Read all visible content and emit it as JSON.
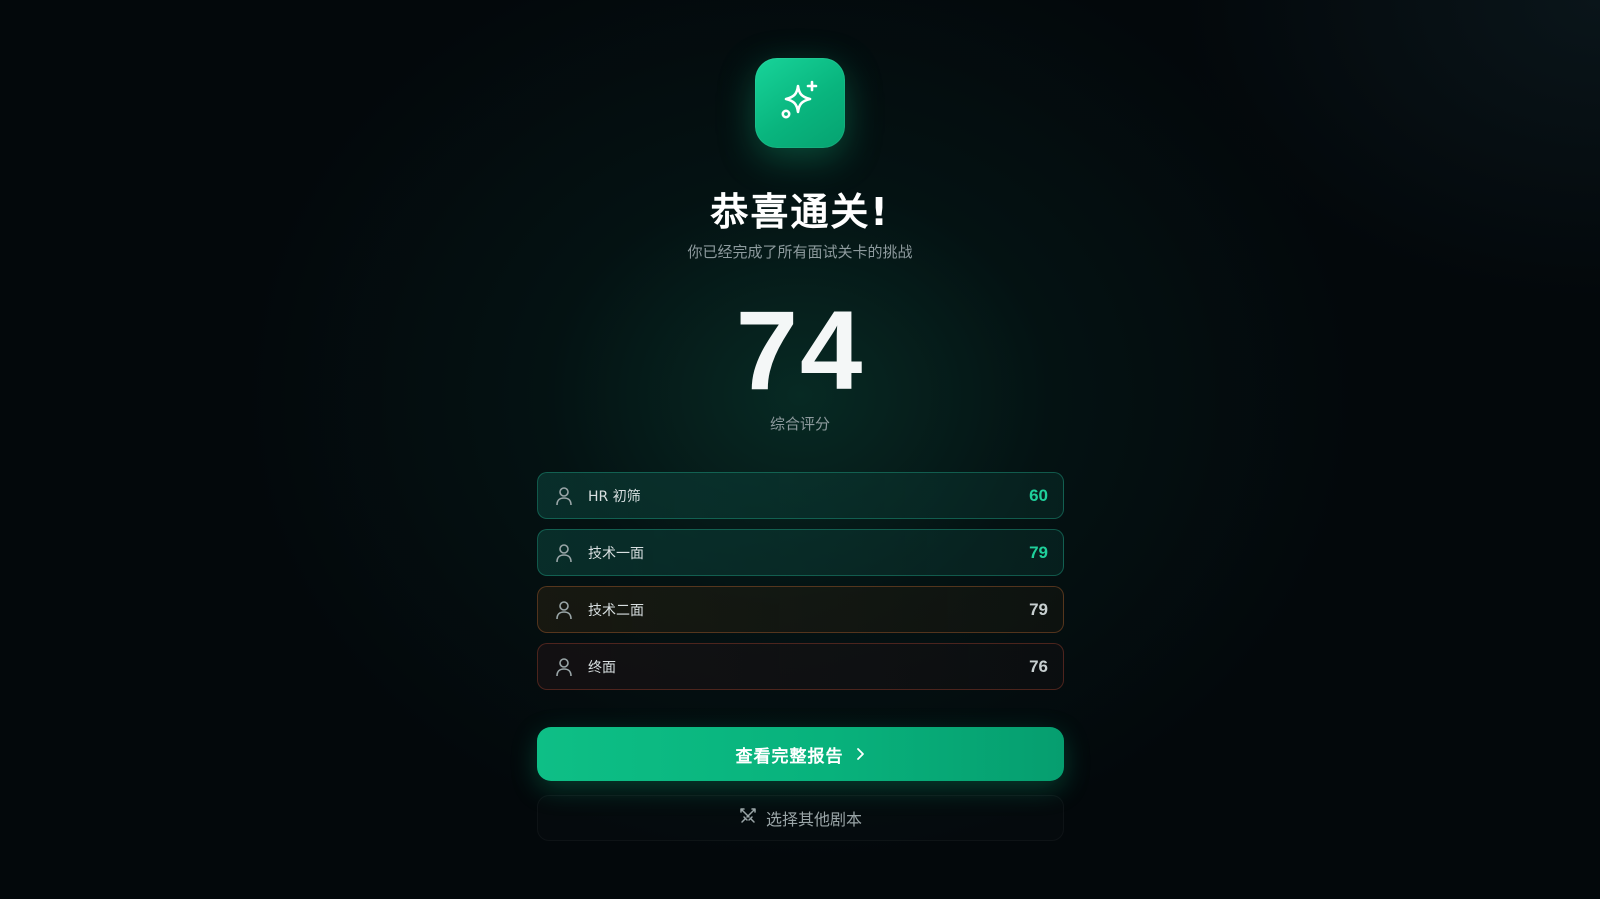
{
  "header": {
    "icon": "sparkles-icon",
    "title": "恭喜通关!",
    "subtitle": "你已经完成了所有面试关卡的挑战"
  },
  "summary": {
    "score": "74",
    "score_label": "综合评分"
  },
  "rounds": [
    {
      "icon": "user-icon",
      "name": "HR 初筛",
      "score": "60"
    },
    {
      "icon": "user-icon",
      "name": "技术一面",
      "score": "79"
    },
    {
      "icon": "user-icon",
      "name": "技术二面",
      "score": "79"
    },
    {
      "icon": "user-icon",
      "name": "终面",
      "score": "76"
    }
  ],
  "actions": {
    "primary_label": "查看完整报告",
    "primary_icon": "chevron-right-icon",
    "secondary_label": "选择其他剧本",
    "secondary_icon": "swords-icon"
  },
  "colors": {
    "accent": "#10b981",
    "background": "#03080b"
  }
}
